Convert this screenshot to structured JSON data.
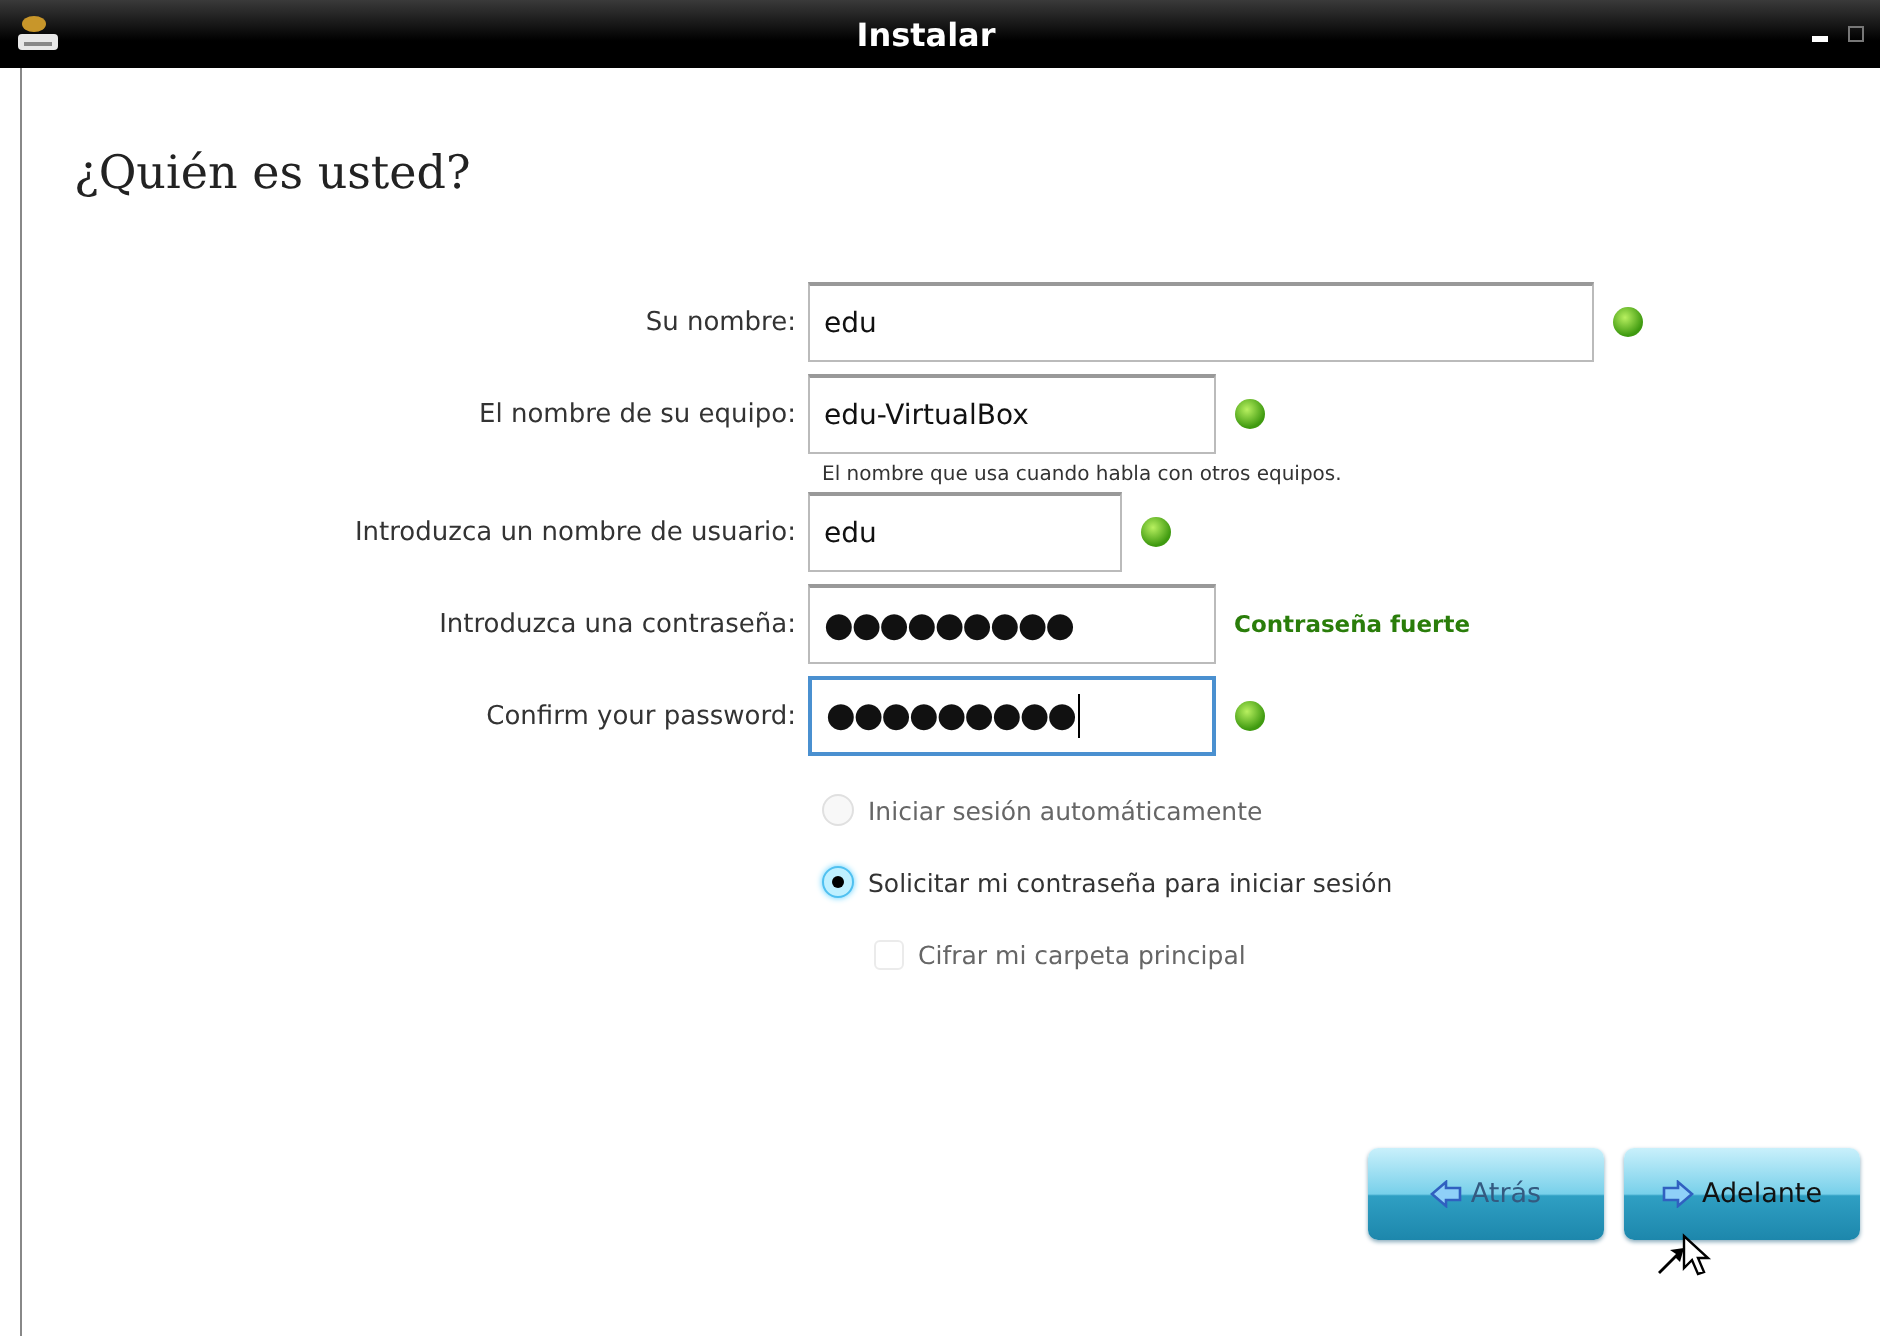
{
  "window": {
    "title": "Instalar"
  },
  "heading": "¿Quién es usted?",
  "fields": [
    {
      "label": "Su nombre:",
      "value": "edu",
      "focused": false,
      "valid": true
    },
    {
      "label": "El nombre de su equipo:",
      "value": "edu-VirtualBox",
      "focused": false,
      "valid": true,
      "hint": "El nombre que usa cuando habla con otros equipos."
    },
    {
      "label": "Introduzca un nombre de usuario:",
      "value": "edu",
      "focused": false,
      "valid": true
    },
    {
      "label": "Introduzca una contraseña:",
      "value": "●●●●●●●●●",
      "focused": false,
      "strength": "Contraseña fuerte"
    },
    {
      "label": "Confirm your password:",
      "value": "●●●●●●●●●",
      "focused": true,
      "valid": true
    }
  ],
  "login_options": [
    {
      "label": "Iniciar sesión automáticamente",
      "selected": false,
      "disabled": true
    },
    {
      "label": "Solicitar mi contraseña para iniciar sesión",
      "selected": true,
      "disabled": false,
      "children": [
        {
          "label": "Cifrar mi carpeta principal",
          "checked": false,
          "disabled": true
        }
      ]
    }
  ],
  "buttons": [
    {
      "label": "Atrás",
      "kind": "back",
      "disabled": true
    },
    {
      "label": "Adelante",
      "kind": "forward",
      "disabled": false
    }
  ]
}
